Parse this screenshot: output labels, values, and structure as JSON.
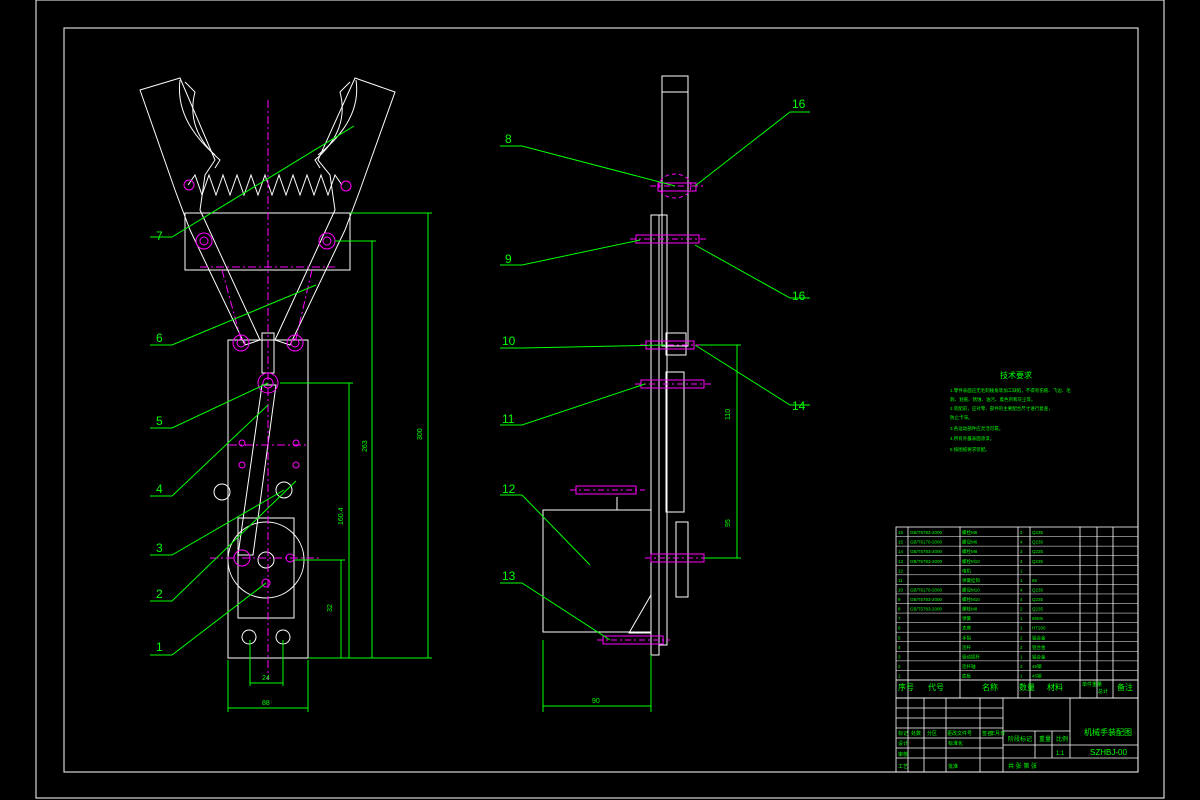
{
  "colors": {
    "background": "#000000",
    "outline": "#ffffff",
    "leader": "#00ff00",
    "centerline": "#ff00ff",
    "dimension": "#00ff00",
    "text_green": "#00ff00",
    "bolt": "#ff00ff",
    "table_text": "#00ff00"
  },
  "callouts": {
    "c1": "1",
    "c2": "2",
    "c3": "3",
    "c4": "4",
    "c5": "5",
    "c6": "6",
    "c7": "7",
    "c8": "8",
    "c9": "9",
    "c10": "10",
    "c11": "11",
    "c12": "12",
    "c13": "13",
    "c14": "14",
    "c15": "16",
    "c16": "16"
  },
  "dimensions": {
    "d_width_front": "88",
    "d_bottom_small": "24",
    "d_height_1": "32",
    "d_height_2": "160.4",
    "d_height_3": "263",
    "d_height_4": "300",
    "d_side_width": "90",
    "d_side_upper": "110",
    "d_side_lower": "95"
  },
  "tech_notes": {
    "title": "技术要求",
    "lines": [
      "1.零件表面应无毛刺棱角等加工缺陷，不得有伤痕、飞边、毛",
      "  刺、划痕、锈蚀、油污、着色剂和灰尘等。",
      "2.装配前，应对零、部件的主要配合尺寸进行复查，",
      "  防止卡滞。",
      "3.各运动部件应灵活可靠。",
      "4.所有外露表面涂漆。",
      "5.按图纸要求装配。"
    ]
  },
  "bom": {
    "rows": [
      [
        "16",
        "GB/T5783-2000",
        "螺栓M6",
        "2",
        "Q235"
      ],
      [
        "15",
        "GB/T6170-2000",
        "螺母M6",
        "4",
        "Q235"
      ],
      [
        "14",
        "GB/T5783-2000",
        "螺栓M8",
        "2",
        "Q235"
      ],
      [
        "13",
        "GB/T5783-2000",
        "螺栓M10",
        "4",
        "Q235"
      ],
      [
        "12",
        "",
        "电机",
        "1",
        ""
      ],
      [
        "11",
        "",
        "弹簧挂钩",
        "1",
        "65"
      ],
      [
        "10",
        "GB/T6170-2000",
        "螺母M10",
        "4",
        "Q235"
      ],
      [
        "9",
        "GB/T5783-2000",
        "螺栓M10",
        "4",
        "Q235"
      ],
      [
        "8",
        "GB/T5783-2000",
        "螺栓M8",
        "2",
        "Q235"
      ],
      [
        "7",
        "",
        "弹簧",
        "1",
        "65Mn"
      ],
      [
        "6",
        "",
        "支座",
        "1",
        "HT200"
      ],
      [
        "5",
        "",
        "手指",
        "2",
        "铝合金"
      ],
      [
        "4",
        "",
        "连杆",
        "2",
        "铝合金"
      ],
      [
        "3",
        "",
        "驱动摇杆",
        "1",
        "铝合金"
      ],
      [
        "2",
        "",
        "连杆轴",
        "2",
        "45钢"
      ],
      [
        "1",
        "",
        "底板",
        "1",
        "45钢"
      ]
    ],
    "headers": [
      "序号",
      "代号",
      "名称",
      "数量",
      "材料",
      "单件重量",
      "总计",
      "备注"
    ]
  },
  "title_block": {
    "drawing_title": "机械手装配图",
    "drawing_number": "SZHBJ-00",
    "scale_label": "比例",
    "scale_value": "1:1",
    "stage_label": "阶段标记",
    "weight_label": "重量",
    "sheet_label": "共 张 第 张",
    "row_labels": [
      "标记",
      "处数",
      "分区",
      "更改文件号",
      "签名",
      "年月日"
    ],
    "sign_labels": [
      "设计",
      "审核",
      "工艺",
      "标准化",
      "批准"
    ]
  }
}
